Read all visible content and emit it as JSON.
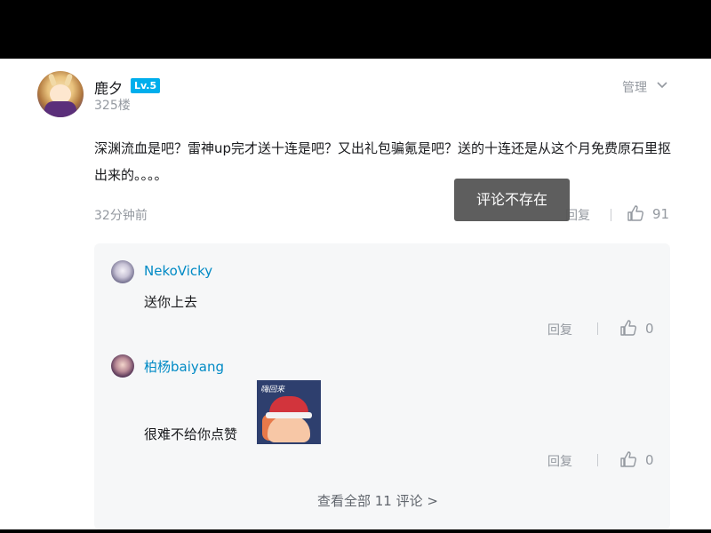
{
  "comment": {
    "username": "鹿夕",
    "level": "Lv.5",
    "floor": "325楼",
    "manage_label": "管理",
    "content": "深渊流血是吧？雷神up完才送十连是吧？又出礼包骗氪是吧？送的十连还是从这个月免费原石里抠出来的。。。。",
    "time": "32分钟前",
    "reply_label": "回复",
    "likes": "91"
  },
  "toast": {
    "text": "评论不存在"
  },
  "replies": [
    {
      "username": "NekoVicky",
      "text": "送你上去",
      "reply_label": "回复",
      "likes": "0"
    },
    {
      "username": "柏杨baiyang",
      "text": "很难不给你点赞",
      "sticker_text": "嗨回来",
      "reply_label": "回复",
      "likes": "0"
    }
  ],
  "view_all": "查看全部 11 评论 >",
  "colors": {
    "accent_blue": "#00aeec",
    "name_blue": "#008ac5",
    "muted_gray": "#9499a0",
    "reply_bg": "#f6f7f8"
  }
}
